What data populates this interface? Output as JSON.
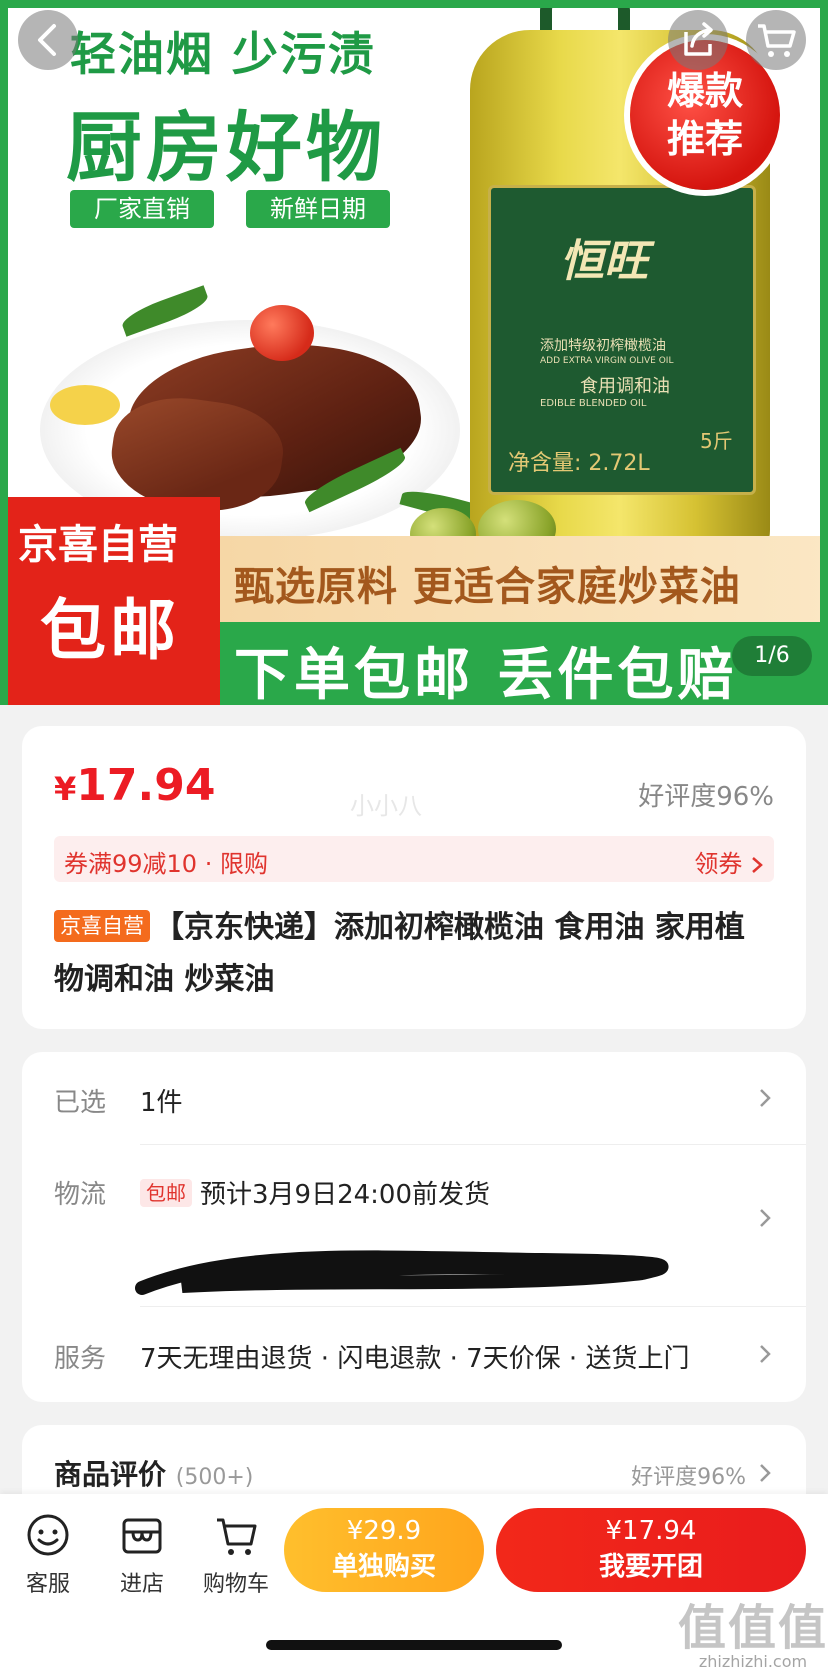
{
  "banner": {
    "headline1": "轻油烟 少污渍",
    "headline2": "厨房好物",
    "tag1": "厂家直销",
    "tag2": "新鲜日期",
    "sticker_line1": "爆款",
    "sticker_line2": "推荐",
    "bottle_brand": "恒旺",
    "bottle_line1": "添加特级初榨橄榄油",
    "bottle_line2": "ADD EXTRA VIRGIN OLIVE OIL",
    "bottle_line3": "食用调和油",
    "bottle_line4": "EDIBLE BLENDED OIL",
    "bottle_net": "净含量: 2.72L",
    "bottle_size": "5斤",
    "promo_left_top": "京喜自营",
    "promo_left_big": "包邮",
    "promo_mid": "甄选原料 更适合家庭炒菜油",
    "promo_bottom": "下单包邮 丢件包赔",
    "counter": "1/6"
  },
  "product": {
    "price_symbol": "¥",
    "price": "17.94",
    "good_rate": "好评度96%",
    "faint_text": "小小八",
    "coupon": "券满99减10 · 限购",
    "coupon_action": "领券",
    "badge": "京喜自营",
    "title": "【京东快递】添加初榨橄榄油 食用油 家用植物调和油 炒菜油"
  },
  "details": {
    "selected_label": "已选",
    "selected_value": "1件",
    "logistics_label": "物流",
    "logistics_badge": "包邮",
    "logistics_value": "预计3月9日24:00前发货",
    "service_label": "服务",
    "service_value": "7天无理由退货 · 闪电退款 · 7天价保 · 送货上门"
  },
  "reviews": {
    "title": "商品评价",
    "count": "(500+)",
    "good_rate": "好评度96%"
  },
  "bottom_bar": {
    "service": "客服",
    "store": "进店",
    "cart": "购物车",
    "single_price": "¥29.9",
    "single_label": "单独购买",
    "group_price": "¥17.94",
    "group_label": "我要开团"
  },
  "watermark": {
    "logo": "值值值",
    "url": "zhizhizhi.com"
  },
  "colors": {
    "brand_red": "#ec1c24",
    "green": "#2aa84a",
    "orange": "#ffa51c"
  }
}
